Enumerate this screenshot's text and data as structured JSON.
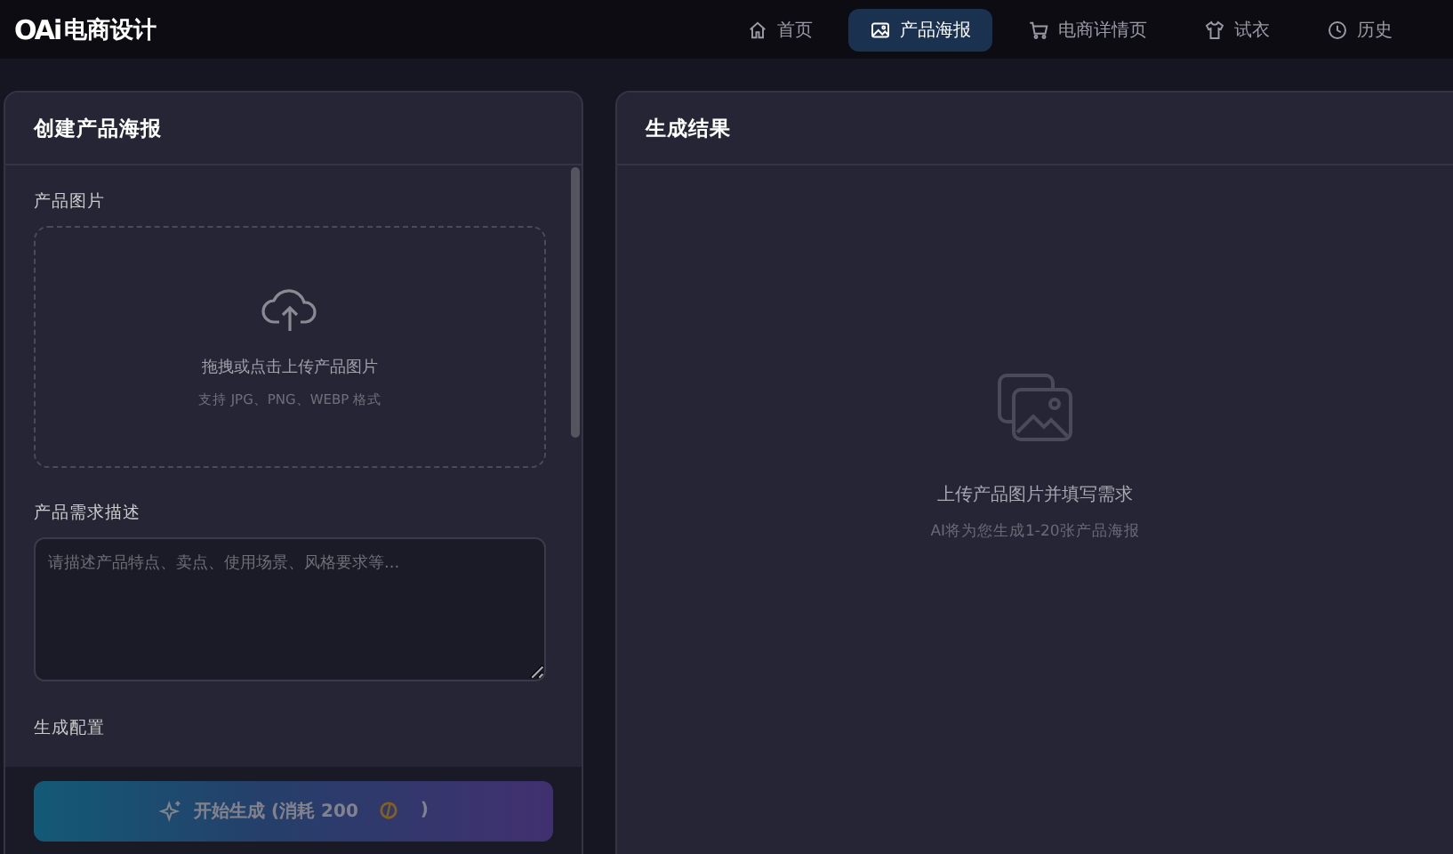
{
  "logo": {
    "mark": "OAi",
    "text": "电商设计"
  },
  "nav": [
    {
      "label": "首页",
      "selected": false
    },
    {
      "label": "产品海报",
      "selected": true
    },
    {
      "label": "电商详情页",
      "selected": false
    },
    {
      "label": "试衣",
      "selected": false
    },
    {
      "label": "历史",
      "selected": false
    }
  ],
  "form": {
    "title": "创建产品海报",
    "image_label": "产品图片",
    "upload_text": "拖拽或点击上传产品图片",
    "upload_hint": "支持 JPG、PNG、WEBP 格式",
    "desc_label": "产品需求描述",
    "desc_placeholder": "请描述产品特点、卖点、使用场景、风格要求等...",
    "config_label": "生成配置",
    "submit": {
      "label": "开始生成 (消耗 200",
      "suffix": ")",
      "disabled": true
    }
  },
  "result": {
    "title": "生成结果",
    "empty_title": "上传产品图片并填写需求",
    "empty_hint": "AI将为您生成1-20张产品海报"
  }
}
